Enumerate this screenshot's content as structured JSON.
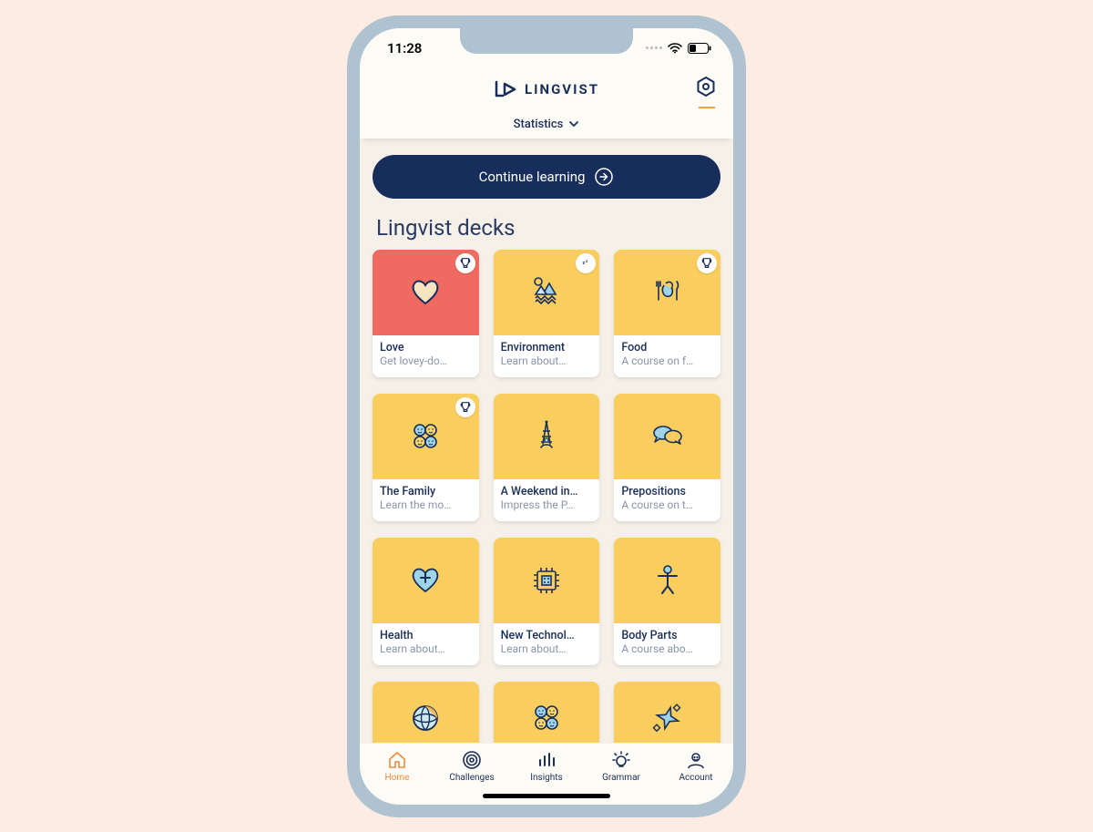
{
  "status": {
    "time": "11:28"
  },
  "header": {
    "brand": "LINGVIST",
    "dropdown_label": "Statistics"
  },
  "cta": {
    "label": "Continue learning"
  },
  "section": {
    "title": "Lingvist decks"
  },
  "decks": [
    {
      "title": "Love",
      "sub": "Get lovey-do…",
      "badge": "trophy",
      "bg": "red",
      "icon": "heart"
    },
    {
      "title": "Environment",
      "sub": "Learn about…",
      "badge": "zz",
      "bg": "yellow",
      "icon": "environment"
    },
    {
      "title": "Food",
      "sub": "A course on f…",
      "badge": "trophy",
      "bg": "yellow",
      "icon": "food"
    },
    {
      "title": "The Family",
      "sub": "Learn the mo…",
      "badge": "trophy",
      "bg": "yellow",
      "icon": "faces"
    },
    {
      "title": "A Weekend in…",
      "sub": "Impress the P…",
      "badge": null,
      "bg": "yellow",
      "icon": "eiffel"
    },
    {
      "title": "Prepositions",
      "sub": "A course on t…",
      "badge": null,
      "bg": "yellow",
      "icon": "chat"
    },
    {
      "title": "Health",
      "sub": "Learn about…",
      "badge": null,
      "bg": "yellow",
      "icon": "health"
    },
    {
      "title": "New Technol…",
      "sub": "Learn about…",
      "badge": null,
      "bg": "yellow",
      "icon": "chip"
    },
    {
      "title": "Body Parts",
      "sub": "A course abo…",
      "badge": null,
      "bg": "yellow",
      "icon": "body"
    }
  ],
  "decks_partial": [
    {
      "icon": "ball"
    },
    {
      "icon": "faces"
    },
    {
      "icon": "sparkle"
    }
  ],
  "tabs": [
    {
      "label": "Home",
      "icon": "home",
      "active": true
    },
    {
      "label": "Challenges",
      "icon": "target",
      "active": false
    },
    {
      "label": "Insights",
      "icon": "bars",
      "active": false
    },
    {
      "label": "Grammar",
      "icon": "bulb",
      "active": false
    },
    {
      "label": "Account",
      "icon": "account",
      "active": false
    }
  ]
}
